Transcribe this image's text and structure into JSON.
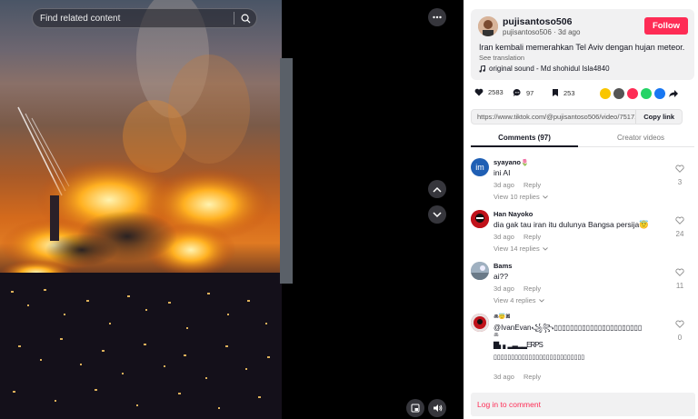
{
  "search": {
    "placeholder": "Find related content"
  },
  "post": {
    "username": "pujisantoso506",
    "handle": "pujisantoso506",
    "time": "3d ago",
    "follow_label": "Follow",
    "caption": "Iran kembali memerahkan Tel Aviv dengan hujan meteor.",
    "see_translation": "See translation",
    "sound": "original sound - Md shohidul Isla4840"
  },
  "stats": {
    "likes": "2583",
    "comments": "97",
    "saves": "253"
  },
  "share_colors": [
    "#f9c600",
    "#555555",
    "#fe2c55",
    "#25d366",
    "#1877f2"
  ],
  "link": {
    "url": "https://www.tiktok.com/@pujisantoso506/video/7517...",
    "copy_label": "Copy link"
  },
  "tabs": {
    "comments": "Comments (97)",
    "creator": "Creator videos"
  },
  "comments": [
    {
      "user": "syayano",
      "user_suffix": "🌷",
      "text": "ini AI",
      "date": "3d ago",
      "reply": "Reply",
      "replies": "View 10 replies",
      "likes": "3",
      "avatar_color": "#1f5fb4",
      "avatar_text": "im"
    },
    {
      "user": "Han Nayoko",
      "user_suffix": "",
      "text": "dia gak tau iran itu dulunya Bangsa persija😇",
      "date": "3d ago",
      "reply": "Reply",
      "replies": "View 14 replies",
      "likes": "24",
      "avatar_color": "#c0121a",
      "avatar_text": ""
    },
    {
      "user": "Bams",
      "user_suffix": "",
      "text": "ai??",
      "date": "3d ago",
      "reply": "Reply",
      "replies": "View 4 replies",
      "likes": "11",
      "avatar_color": "#8a9aa8",
      "avatar_text": ""
    },
    {
      "user": "ꔛ😇ꕤ",
      "user_suffix": "",
      "text": "@IvanEvan꧁꧂▯▯▯▯▯▯▯▯▯▯▯▯▯▯▯▯▯▯▯▯▯▯",
      "line2": "ꔛ",
      "line3": "▇▖▖▂▃▂▂ERPS",
      "line4": "▯▯▯▯▯▯▯▯▯▯▯▯▯▯▯▯▯▯▯▯▯▯▯▯▯▯",
      "date": "3d ago",
      "reply": "Reply",
      "likes": "0",
      "avatar_color": "#c0121a",
      "avatar_text": ""
    }
  ],
  "login": {
    "label": "Log in to comment"
  }
}
